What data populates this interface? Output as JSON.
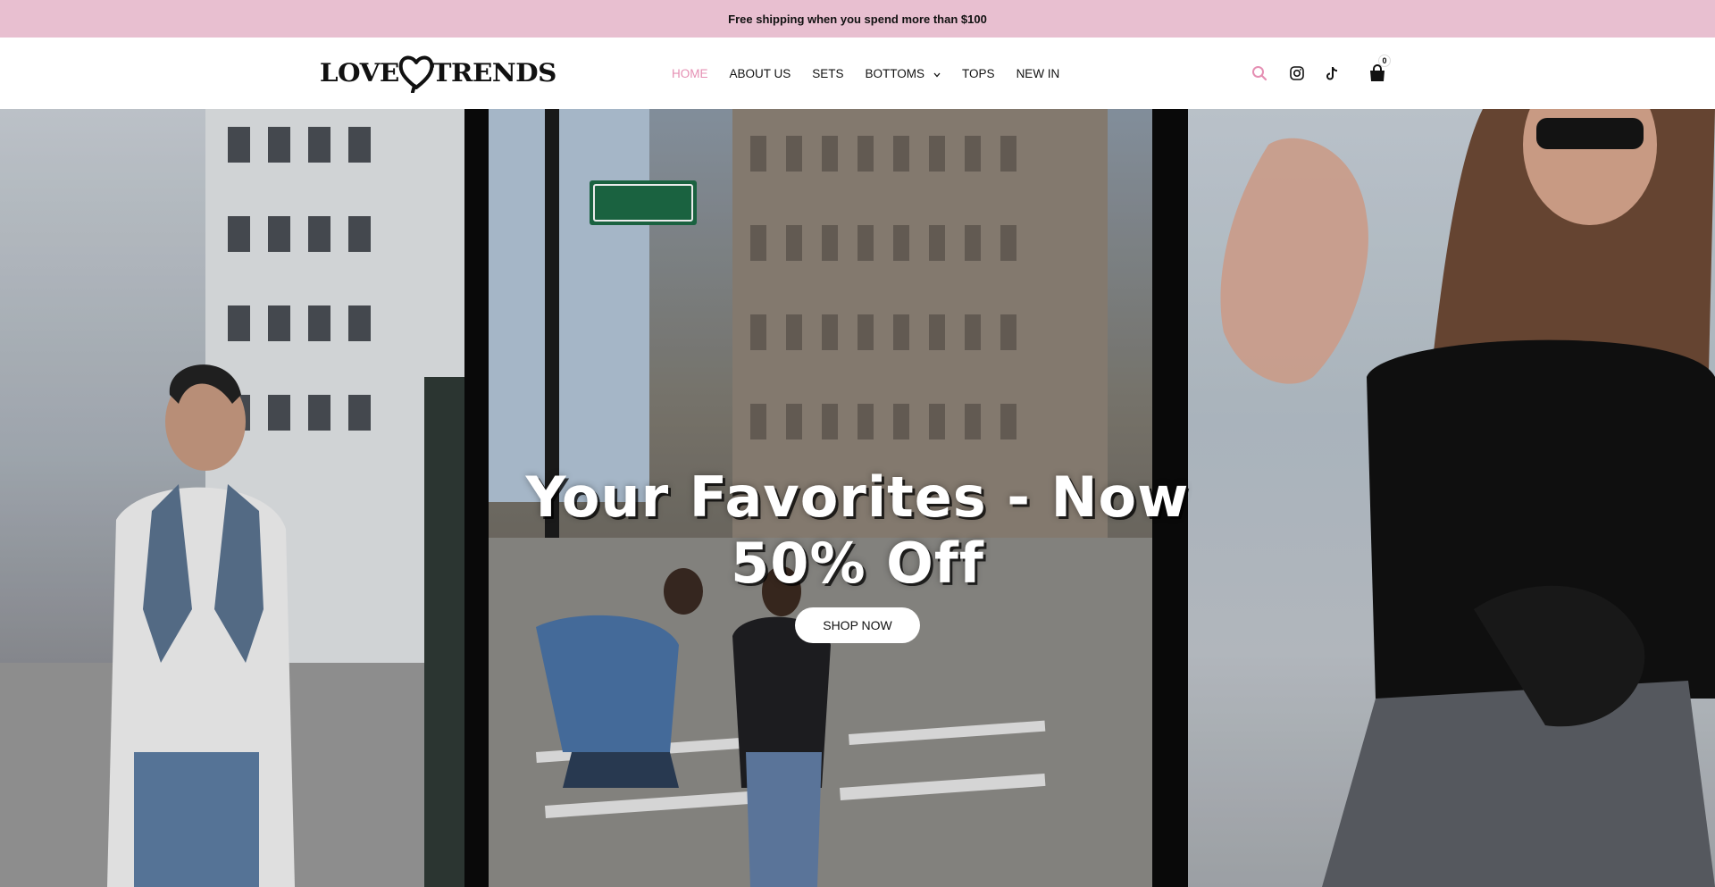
{
  "announcement": {
    "text": "Free shipping when you spend more than $100"
  },
  "logo": {
    "left_word": "LOVE",
    "right_word": "TRENDS"
  },
  "nav": {
    "items": [
      {
        "label": "HOME",
        "active": true
      },
      {
        "label": "ABOUT US",
        "active": false
      },
      {
        "label": "SETS",
        "active": false
      },
      {
        "label": "BOTTOMS",
        "active": false,
        "has_dropdown": true
      },
      {
        "label": "TOPS",
        "active": false
      },
      {
        "label": "NEW IN",
        "active": false
      }
    ]
  },
  "header_icons": {
    "search": "search-icon",
    "instagram": "instagram-icon",
    "tiktok": "tiktok-icon",
    "cart": "shopping-bag-icon",
    "cart_count": "0"
  },
  "hero": {
    "title_line1": "Your Favorites - Now",
    "title_line2": "50% Off",
    "cta_label": "SHOP NOW"
  },
  "colors": {
    "announcement_bg": "#e8bfd0",
    "accent": "#e58fb3",
    "text": "#111111"
  }
}
